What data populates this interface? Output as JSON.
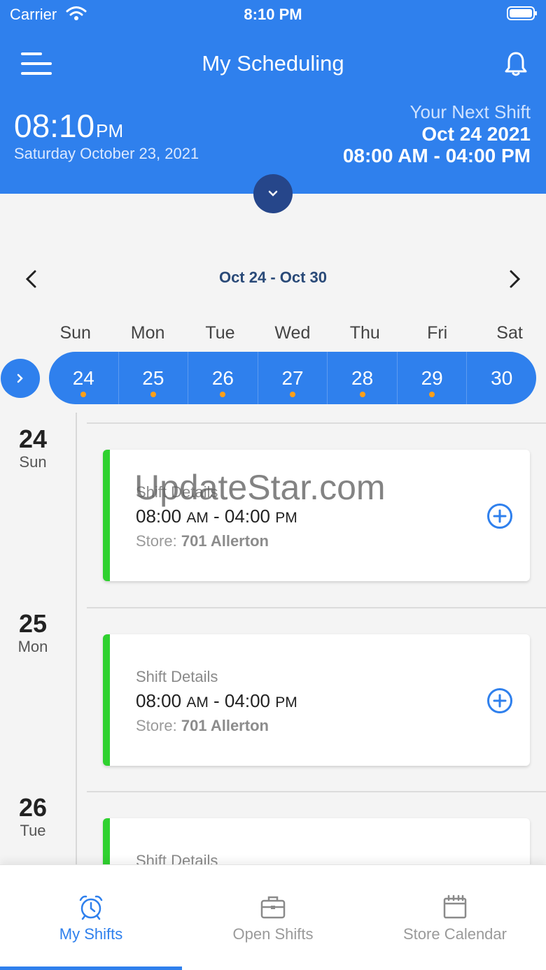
{
  "status_bar": {
    "carrier": "Carrier",
    "time": "8:10 PM"
  },
  "header": {
    "title": "My Scheduling",
    "current_time": "08:10",
    "current_ampm": "PM",
    "current_date": "Saturday October 23, 2021",
    "next_shift_label": "Your Next Shift",
    "next_shift_date": "Oct 24 2021",
    "next_shift_time": "08:00 AM - 04:00 PM"
  },
  "week": {
    "range": "Oct 24 - Oct 30",
    "day_names": [
      "Sun",
      "Mon",
      "Tue",
      "Wed",
      "Thu",
      "Fri",
      "Sat"
    ],
    "dates": [
      "24",
      "25",
      "26",
      "27",
      "28",
      "29",
      "30"
    ],
    "has_shift": [
      true,
      true,
      true,
      true,
      true,
      true,
      false
    ]
  },
  "schedule": [
    {
      "day": "24",
      "dow": "Sun",
      "label": "Shift Details",
      "start": "08:00",
      "start_ampm": "AM",
      "end": "04:00",
      "end_ampm": "PM",
      "store_label": "Store:",
      "store": "701 Allerton"
    },
    {
      "day": "25",
      "dow": "Mon",
      "label": "Shift Details",
      "start": "08:00",
      "start_ampm": "AM",
      "end": "04:00",
      "end_ampm": "PM",
      "store_label": "Store:",
      "store": "701 Allerton"
    },
    {
      "day": "26",
      "dow": "Tue",
      "label": "Shift Details"
    }
  ],
  "watermark": "UpdateStar.com",
  "bottom_nav": {
    "items": [
      {
        "label": "My Shifts",
        "active": true
      },
      {
        "label": "Open Shifts",
        "active": false
      },
      {
        "label": "Store Calendar",
        "active": false
      }
    ]
  },
  "colors": {
    "primary": "#2f80ed",
    "dark_button": "#26468a",
    "shift_accent": "#2fd12f",
    "dot": "#ff9f1a",
    "inactive_nav": "#9a9a9a"
  }
}
